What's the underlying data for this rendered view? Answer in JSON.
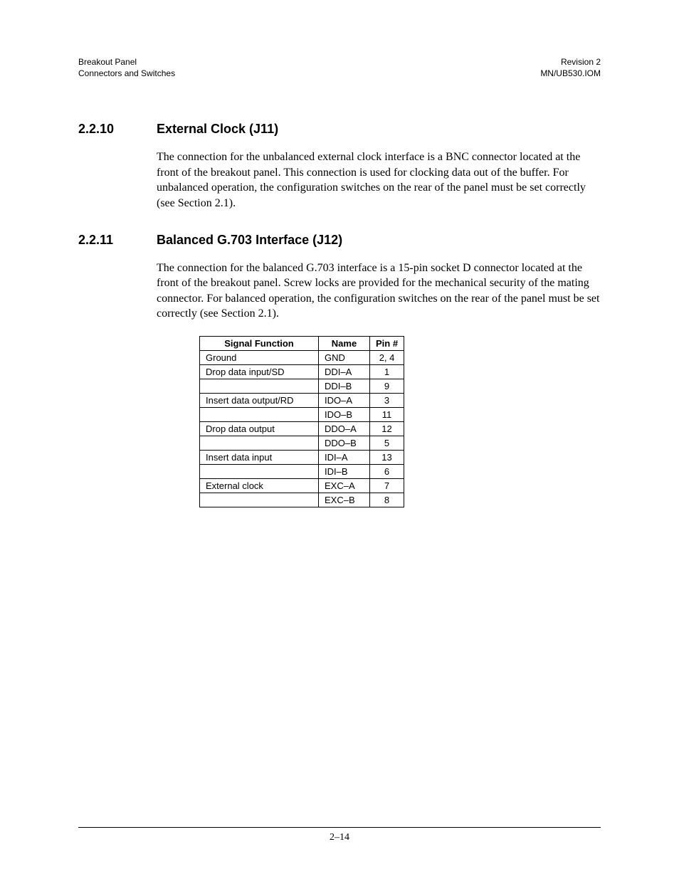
{
  "header": {
    "left_line1": "Breakout Panel",
    "left_line2": "Connectors and Switches",
    "right_line1": "Revision 2",
    "right_line2": "MN/UB530.IOM"
  },
  "sections": {
    "s1": {
      "num": "2.2.10",
      "title": "External Clock (J11)",
      "para": "The connection for the unbalanced external clock interface is a BNC connector  located at the front of the breakout panel. This connection is used for clocking data out of the buffer. For unbalanced operation, the configuration switches on the rear of the panel must be set correctly (see Section 2.1)."
    },
    "s2": {
      "num": "2.2.11",
      "title": "Balanced G.703 Interface (J12)",
      "para": "The connection for the balanced G.703 interface is a 15-pin socket D connector located at the front of the breakout panel. Screw locks are provided for the mechanical security of the mating connector. For balanced operation, the configuration switches on the rear of the panel must be set correctly (see Section 2.1)."
    }
  },
  "table": {
    "headers": {
      "func": "Signal Function",
      "name": "Name",
      "pin": "Pin #"
    },
    "rows": [
      {
        "func": "Ground",
        "name": "GND",
        "pin": "2, 4"
      },
      {
        "func": "Drop data input/SD",
        "name": "DDI–A",
        "pin": "1"
      },
      {
        "func": "",
        "name": "DDI–B",
        "pin": "9"
      },
      {
        "func": "Insert data output/RD",
        "name": "IDO–A",
        "pin": "3"
      },
      {
        "func": "",
        "name": "IDO–B",
        "pin": "11"
      },
      {
        "func": "Drop data output",
        "name": "DDO–A",
        "pin": "12"
      },
      {
        "func": "",
        "name": "DDO–B",
        "pin": "5"
      },
      {
        "func": "Insert data input",
        "name": "IDI–A",
        "pin": "13"
      },
      {
        "func": "",
        "name": "IDI–B",
        "pin": "6"
      },
      {
        "func": "External clock",
        "name": "EXC–A",
        "pin": "7"
      },
      {
        "func": "",
        "name": "EXC–B",
        "pin": "8"
      }
    ]
  },
  "footer": {
    "page_num": "2–14"
  }
}
